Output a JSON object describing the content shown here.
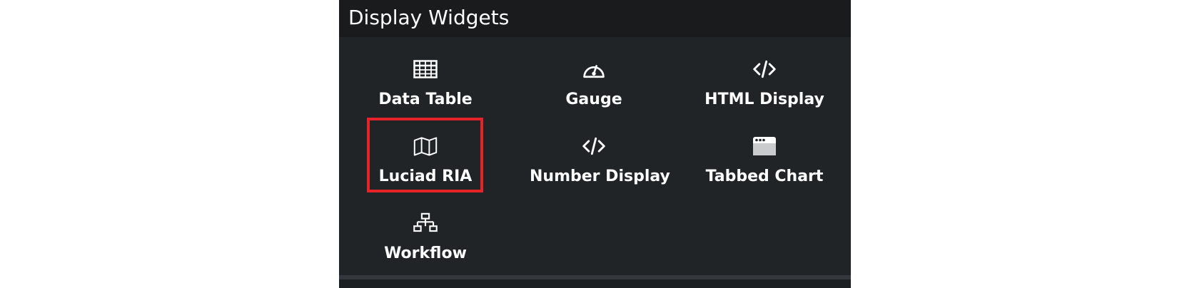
{
  "panel": {
    "title": "Display Widgets"
  },
  "widgets": [
    {
      "label": "Data Table",
      "icon": "table-icon"
    },
    {
      "label": "Gauge",
      "icon": "gauge-icon"
    },
    {
      "label": "HTML Display",
      "icon": "code-icon"
    },
    {
      "label": "Luciad RIA",
      "icon": "map-icon",
      "selected": true
    },
    {
      "label": "Number Display",
      "icon": "code-icon"
    },
    {
      "label": "Tabbed Chart",
      "icon": "browser-window-icon"
    },
    {
      "label": "Workflow",
      "icon": "sitemap-icon"
    }
  ],
  "colors": {
    "panel_bg": "#202427",
    "header_bg": "#191b1d",
    "highlight": "#e52329",
    "text": "#ffffff"
  }
}
